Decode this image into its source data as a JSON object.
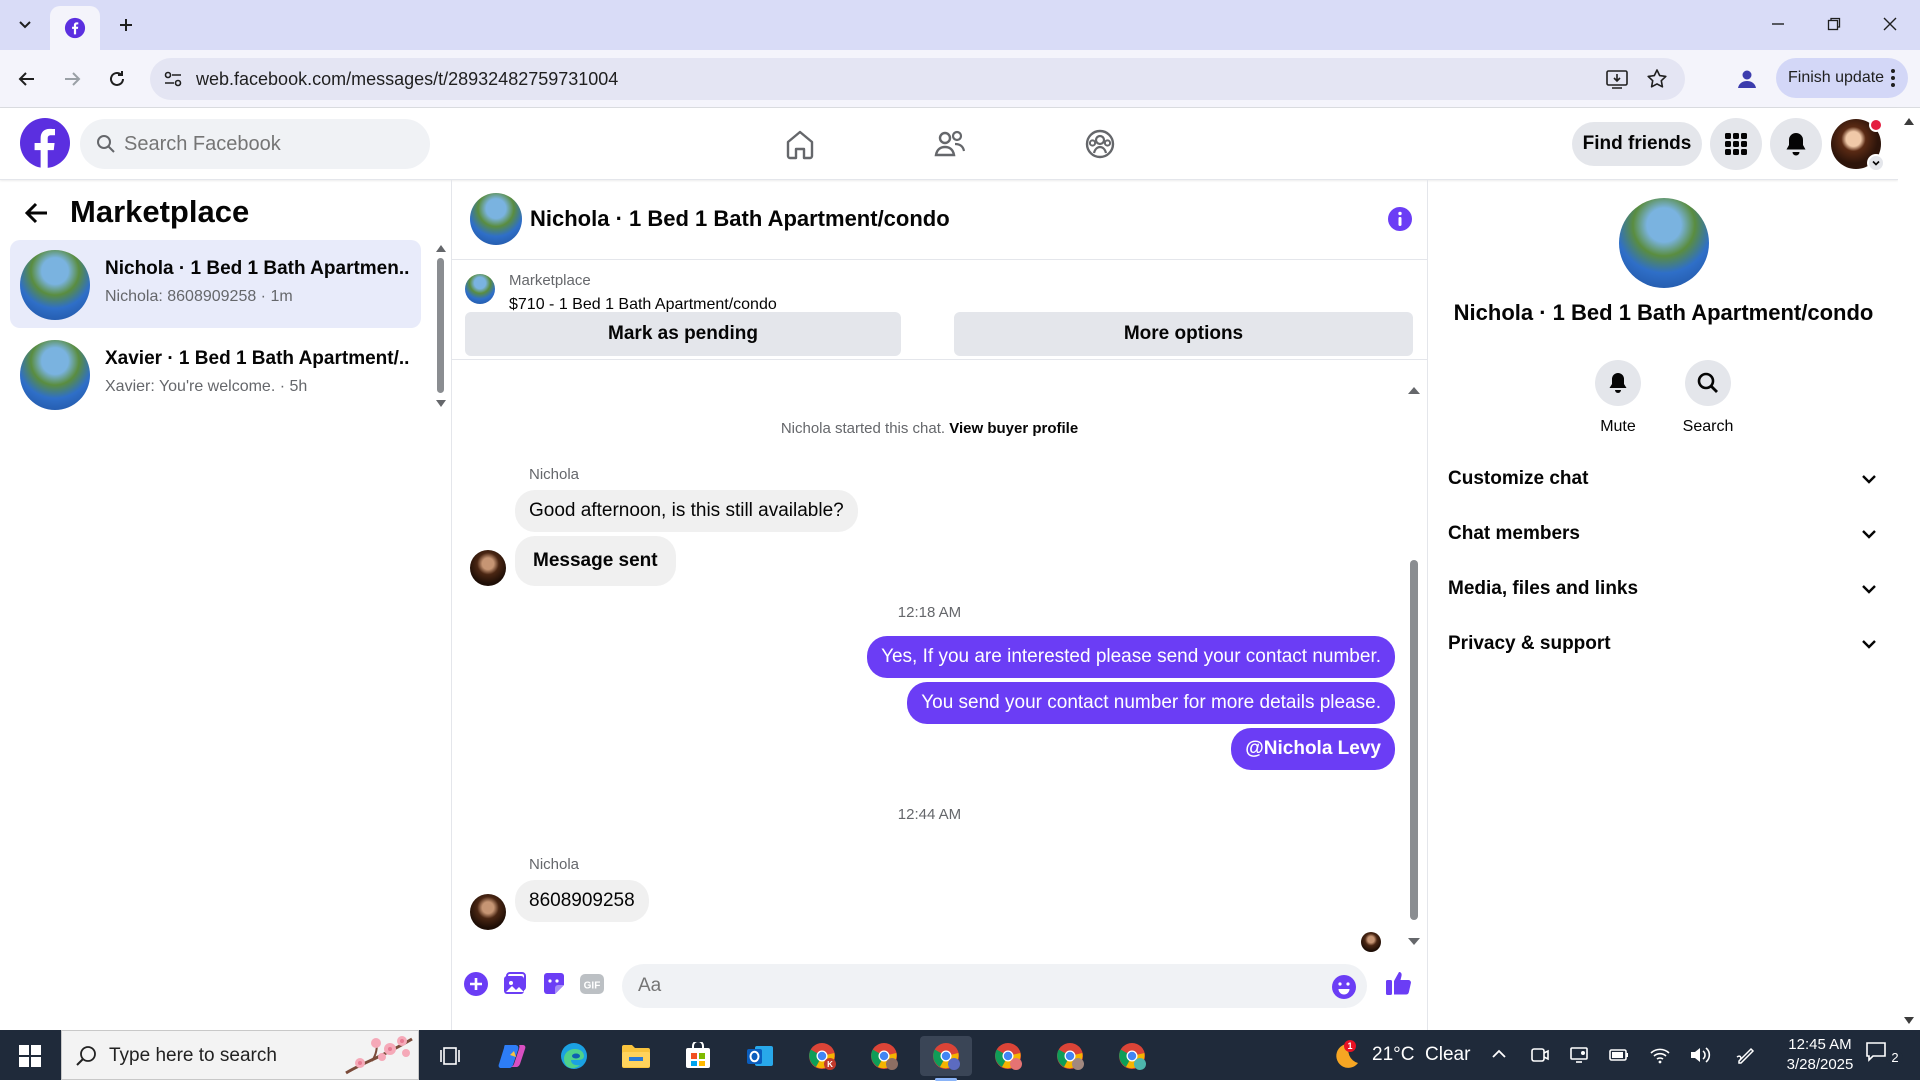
{
  "browser": {
    "url": "web.facebook.com/messages/t/28932482759731004",
    "finish_update": "Finish update"
  },
  "fb": {
    "search_placeholder": "Search Facebook",
    "find_friends": "Find friends"
  },
  "left": {
    "title": "Marketplace",
    "conversations": [
      {
        "name": "Nichola · 1 Bed 1 Bath Apartmen...",
        "snippet": "Nichola: 8608909258 · 1m"
      },
      {
        "name": "Xavier · 1 Bed 1 Bath Apartment/...",
        "snippet": "Xavier: You're welcome. · 5h"
      }
    ]
  },
  "chat": {
    "title": "Nichola · 1 Bed 1 Bath Apartment/condo",
    "listing_label": "Marketplace",
    "listing_price": "$710 - 1 Bed 1 Bath Apartment/condo",
    "mark_pending": "Mark as pending",
    "more_options": "More options",
    "started": "Nichola started this chat.",
    "view_profile": "View buyer profile",
    "sender_1": "Nichola",
    "msg_1": "Good afternoon, is this still available?",
    "msg_2": "Message sent",
    "time_1": "12:18 AM",
    "out_1": "Yes, If you are interested please send your contact number.",
    "out_2": "You send your contact number for more details please.",
    "out_3": "@Nichola Levy",
    "time_2": "12:44 AM",
    "sender_2": "Nichola",
    "msg_3": "8608909258",
    "composer_placeholder": "Aa"
  },
  "right": {
    "name": "Nichola · 1 Bed 1 Bath Apartment/condo",
    "mute": "Mute",
    "search": "Search",
    "sections": [
      "Customize chat",
      "Chat members",
      "Media, files and links",
      "Privacy & support"
    ]
  },
  "taskbar": {
    "search_placeholder": "Type here to search",
    "weather": "21°C  Clear",
    "time": "12:45 AM",
    "date": "3/28/2025",
    "notif_count": "2"
  },
  "colors": {
    "accent": "#6b3df5",
    "fb_logo": "#5b2fe0"
  }
}
